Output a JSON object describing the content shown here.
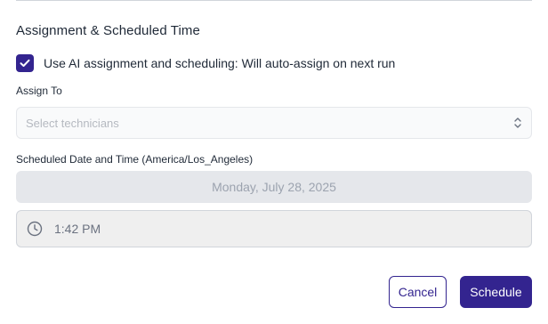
{
  "section": {
    "title": "Assignment & Scheduled Time"
  },
  "ai_assignment": {
    "checked": true,
    "label": "Use AI assignment and scheduling: Will auto-assign on next run"
  },
  "assign_to": {
    "label": "Assign To",
    "placeholder": "Select technicians"
  },
  "schedule": {
    "label": "Scheduled Date and Time (America/Los_Angeles)",
    "date": "Monday, July 28, 2025",
    "time": "1:42 PM"
  },
  "actions": {
    "cancel_label": "Cancel",
    "schedule_label": "Schedule"
  },
  "colors": {
    "accent": "#33248f",
    "disabled_bg": "#e5e7eb",
    "border": "#d1d5db"
  },
  "icons": {
    "checkbox": "check-icon",
    "select": "chevron-up-down-icon",
    "time": "clock-icon"
  }
}
